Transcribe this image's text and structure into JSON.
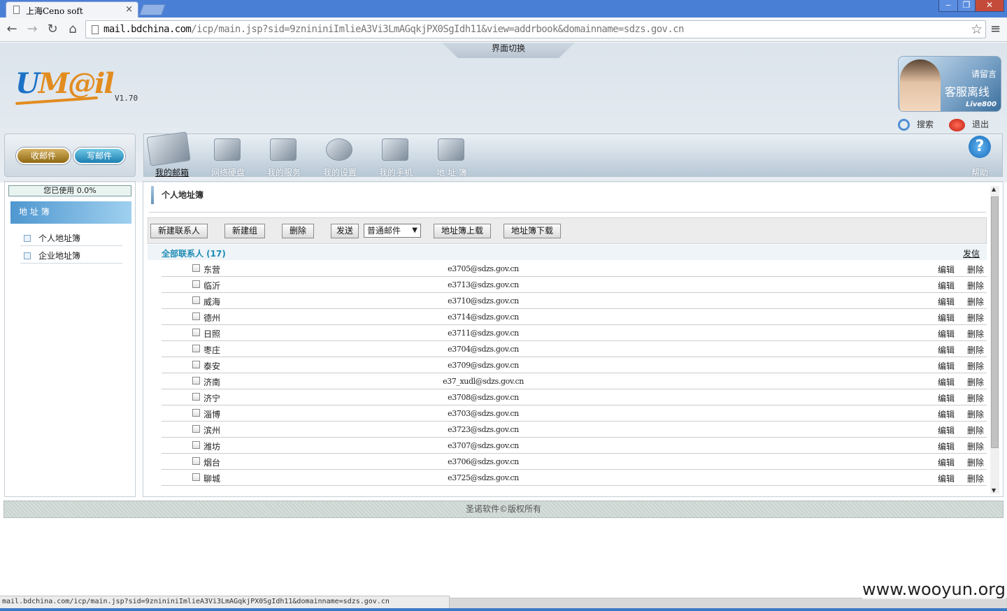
{
  "browser": {
    "tab_title": "上海Ceno soft",
    "tab_close": "×",
    "url_host": "mail.bdchina.com",
    "url_path": "/icp/main.jsp?sid=9znininiImlieA3Vi3LmAGqkjPX0SgIdh11&view=addrbook&domainname=sdzs.gov.cn",
    "status_url": "mail.bdchina.com/icp/main.jsp?sid=9znininiImlieA3Vi3LmAGqkjPX0SgIdh11&domainname=sdzs.gov.cn"
  },
  "header": {
    "ui_switch": "界面切换",
    "version": "V1.70",
    "live_leave_msg": "请留言",
    "live_status": "客服离线",
    "live_brand": "Live800",
    "search": "搜索",
    "logout": "退出"
  },
  "mail_buttons": {
    "receive": "收邮件",
    "compose": "写邮件"
  },
  "nav": [
    {
      "label": "我的邮箱",
      "active": true
    },
    {
      "label": "网络硬盘"
    },
    {
      "label": "我的服务"
    },
    {
      "label": "我的设置"
    },
    {
      "label": "我的手机"
    },
    {
      "label": "地 址 簿"
    }
  ],
  "help": "帮助",
  "sidebar": {
    "usage": "您已使用 0.0%",
    "header": "地 址 簿",
    "items": [
      "个人地址簿",
      "企业地址簿"
    ]
  },
  "main": {
    "title": "个人地址簿",
    "buttons": {
      "new_contact": "新建联系人",
      "new_group": "新建组",
      "delete": "删除",
      "send": "发送",
      "mail_type": "普通邮件",
      "upload": "地址簿上载",
      "download": "地址簿下载"
    },
    "group_name": "全部联系人 (17)",
    "group_send": "发信",
    "edit_label": "编辑",
    "delete_label": "删除",
    "contacts": [
      {
        "name": "东营",
        "email": "e3705@sdzs.gov.cn"
      },
      {
        "name": "临沂",
        "email": "e3713@sdzs.gov.cn"
      },
      {
        "name": "威海",
        "email": "e3710@sdzs.gov.cn"
      },
      {
        "name": "德州",
        "email": "e3714@sdzs.gov.cn"
      },
      {
        "name": "日照",
        "email": "e3711@sdzs.gov.cn"
      },
      {
        "name": "枣庄",
        "email": "e3704@sdzs.gov.cn"
      },
      {
        "name": "泰安",
        "email": "e3709@sdzs.gov.cn"
      },
      {
        "name": "济南",
        "email": "e37_xudl@sdzs.gov.cn"
      },
      {
        "name": "济宁",
        "email": "e3708@sdzs.gov.cn"
      },
      {
        "name": "淄博",
        "email": "e3703@sdzs.gov.cn"
      },
      {
        "name": "滨州",
        "email": "e3723@sdzs.gov.cn"
      },
      {
        "name": "潍坊",
        "email": "e3707@sdzs.gov.cn"
      },
      {
        "name": "烟台",
        "email": "e3706@sdzs.gov.cn"
      },
      {
        "name": "聊城",
        "email": "e3725@sdzs.gov.cn"
      }
    ]
  },
  "footer": "圣诺软件©版权所有",
  "watermark": "www.wooyun.org"
}
